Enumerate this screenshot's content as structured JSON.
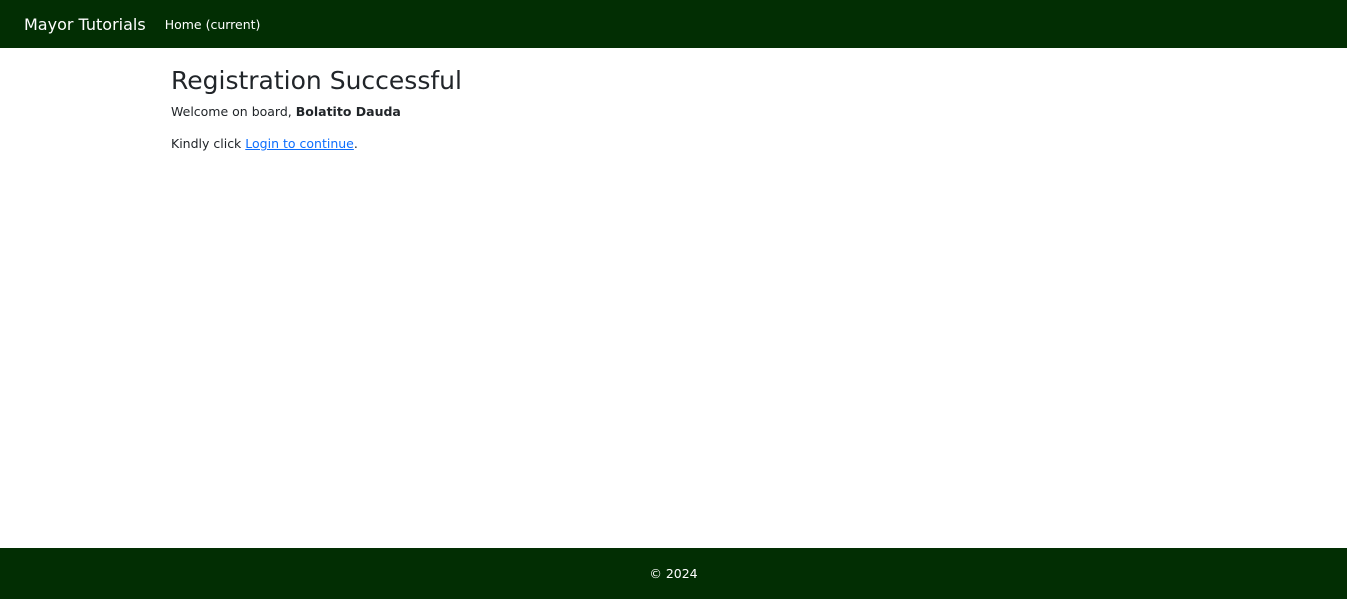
{
  "navbar": {
    "brand": "Mayor Tutorials",
    "home_link": "Home (current)",
    "background": "#022e03"
  },
  "main": {
    "title": "Registration Successful",
    "welcome_prefix": "Welcome on board, ",
    "user_name": "Bolatito Dauda",
    "kindly_prefix": "Kindly click ",
    "login_link": "Login to continue",
    "kindly_suffix": "."
  },
  "footer": {
    "copyright": "© 2024"
  },
  "colors": {
    "brand_green": "#022e03",
    "link_blue": "#0d6efd",
    "text": "#212529"
  }
}
